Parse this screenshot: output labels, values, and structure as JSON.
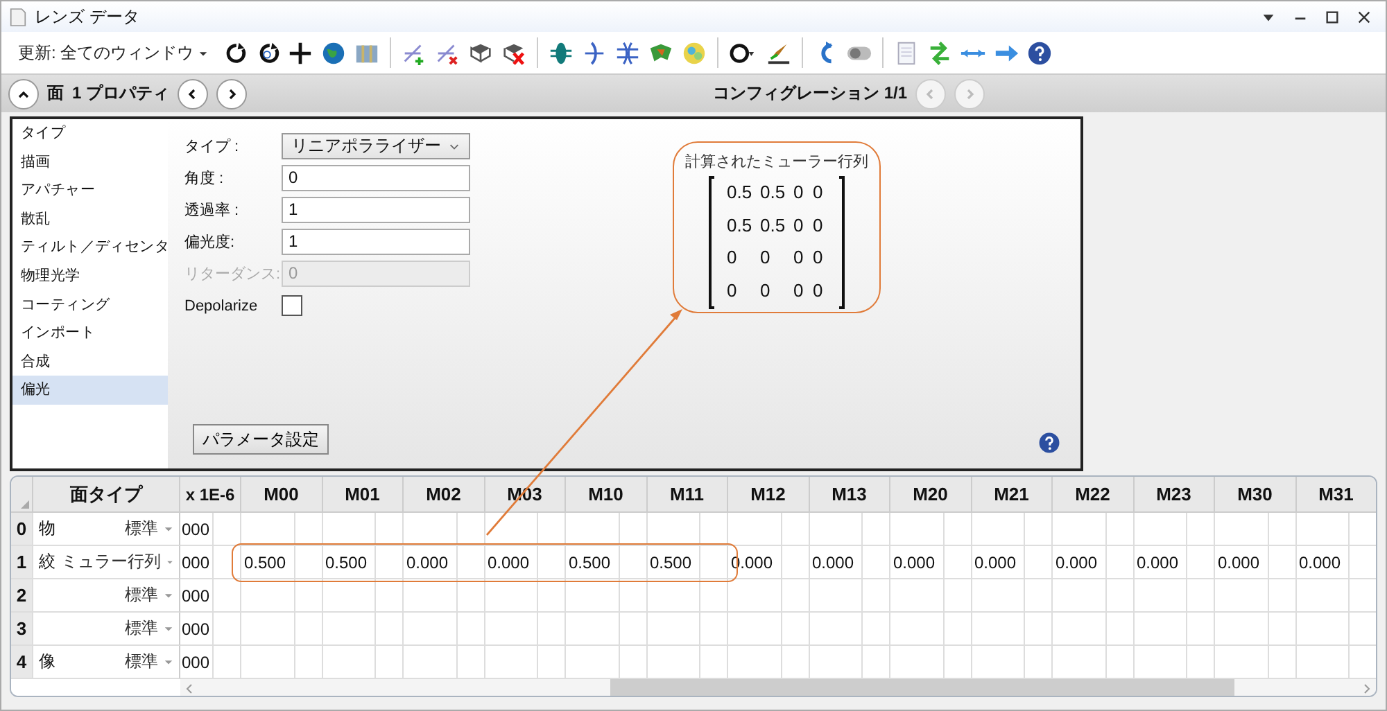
{
  "window": {
    "title": "レンズ データ"
  },
  "toolbar": {
    "update_menu": "更新: 全てのウィンドウ"
  },
  "nav": {
    "surface_label": "面",
    "surface_property": "1 プロパティ",
    "configuration": "コンフィグレーション 1/1",
    "config_buttons_disabled": true
  },
  "categories": [
    {
      "label": "タイプ",
      "selected": false
    },
    {
      "label": "描画",
      "selected": false
    },
    {
      "label": "アパチャー",
      "selected": false
    },
    {
      "label": "散乱",
      "selected": false
    },
    {
      "label": "ティルト／ディセンタ",
      "selected": false
    },
    {
      "label": "物理光学",
      "selected": false
    },
    {
      "label": "コーティング",
      "selected": false
    },
    {
      "label": "インポート",
      "selected": false
    },
    {
      "label": "合成",
      "selected": false
    },
    {
      "label": "偏光",
      "selected": true
    }
  ],
  "form": {
    "fields": [
      {
        "kind": "dropdown",
        "label": "タイプ :",
        "value": "リニアポラライザー",
        "disabled": false
      },
      {
        "kind": "text",
        "label": "角度 :",
        "value": "0",
        "disabled": false
      },
      {
        "kind": "text",
        "label": "透過率 :",
        "value": "1",
        "disabled": false
      },
      {
        "kind": "text",
        "label": "偏光度:",
        "value": "1",
        "disabled": false
      },
      {
        "kind": "text",
        "label": "リターダンス:",
        "value": "0",
        "disabled": true
      },
      {
        "kind": "checkbox",
        "label": "Depolarize",
        "checked": false
      }
    ]
  },
  "parameter_button": "パラメータ設定",
  "mueller_matrix": {
    "title": "計算されたミューラー行列",
    "rows": [
      [
        "0.5",
        "0.5",
        "0",
        "0"
      ],
      [
        "0.5",
        "0.5",
        "0",
        "0"
      ],
      [
        "0",
        "0",
        "0",
        "0"
      ],
      [
        "0",
        "0",
        "0",
        "0"
      ]
    ]
  },
  "table": {
    "type_header": "面タイプ",
    "partial_header": "x 1E-6",
    "columns": [
      "M00",
      "M01",
      "M02",
      "M03",
      "M10",
      "M11",
      "M12",
      "M13",
      "M20",
      "M21",
      "M22",
      "M23",
      "M30",
      "M31"
    ],
    "rows": [
      {
        "index": "0",
        "comment": "物",
        "type": "標準",
        "partial": "000"
      },
      {
        "index": "1",
        "comment": "絞",
        "type": "ミュラー行列",
        "partial": "000",
        "values": [
          "0.500",
          "0.500",
          "0.000",
          "0.000",
          "0.500",
          "0.500",
          "0.000",
          "0.000",
          "0.000",
          "0.000",
          "0.000",
          "0.000",
          "0.000",
          "0.000"
        ]
      },
      {
        "index": "2",
        "type": "標準",
        "partial": "000"
      },
      {
        "index": "3",
        "type": "標準",
        "partial": "000"
      },
      {
        "index": "4",
        "comment": "像",
        "type": "標準",
        "partial": "000"
      }
    ]
  }
}
